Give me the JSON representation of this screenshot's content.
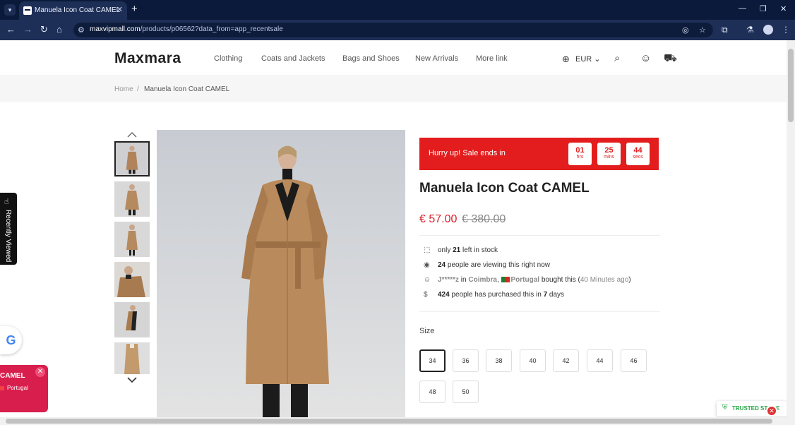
{
  "browser": {
    "tab_title": "Manuela Icon Coat CAMEL",
    "new_tab_label": "+",
    "url_host": "maxvipmall.com",
    "url_path": "/products/p06562?data_from=app_recentsale"
  },
  "site": {
    "logo": "Maxmara",
    "nav": [
      "Clothing",
      "Coats and Jackets",
      "Bags and Shoes",
      "New Arrivals",
      "More link"
    ],
    "currency": "EUR"
  },
  "breadcrumb": {
    "home": "Home",
    "separator": "/",
    "current": "Manuela Icon Coat CAMEL"
  },
  "product": {
    "sale_text": "Hurry up!  Sale ends in",
    "timer": [
      {
        "value": "01",
        "unit": "hrs"
      },
      {
        "value": "25",
        "unit": "mins"
      },
      {
        "value": "44",
        "unit": "secs"
      }
    ],
    "title": "Manuela Icon Coat CAMEL",
    "price": "€ 57.00",
    "old_price": "€ 380.00",
    "stock": {
      "pre": "only ",
      "count": "21",
      "post": " left in stock"
    },
    "viewing": {
      "count": "24",
      "post": " people are viewing this right now"
    },
    "recent_buyer": {
      "name": "J*****z",
      "in": " in ",
      "city": "Coimbra",
      "comma": ", ",
      "country": "Portugal",
      "action": " bought this (",
      "ago": "40 Minutes ago",
      "close_paren": ")"
    },
    "purchased": {
      "count": "424",
      "mid": " people has purchased this in ",
      "days": "7",
      "post": " days"
    },
    "size_label": "Size",
    "sizes": [
      "34",
      "36",
      "38",
      "40",
      "42",
      "44",
      "46",
      "48",
      "50"
    ],
    "selected_size": "34"
  },
  "overlays": {
    "recently_viewed": "Recently Viewed",
    "google_badge": "G",
    "popup_title": "CAMEL",
    "popup_location": "Portugal",
    "trusted_store": "TRUSTED STORE"
  },
  "colors": {
    "sale_red": "#e31d1d",
    "price_red": "#d81e2a",
    "popup_pink": "#d81e4d",
    "trusted_green": "#28a745"
  }
}
